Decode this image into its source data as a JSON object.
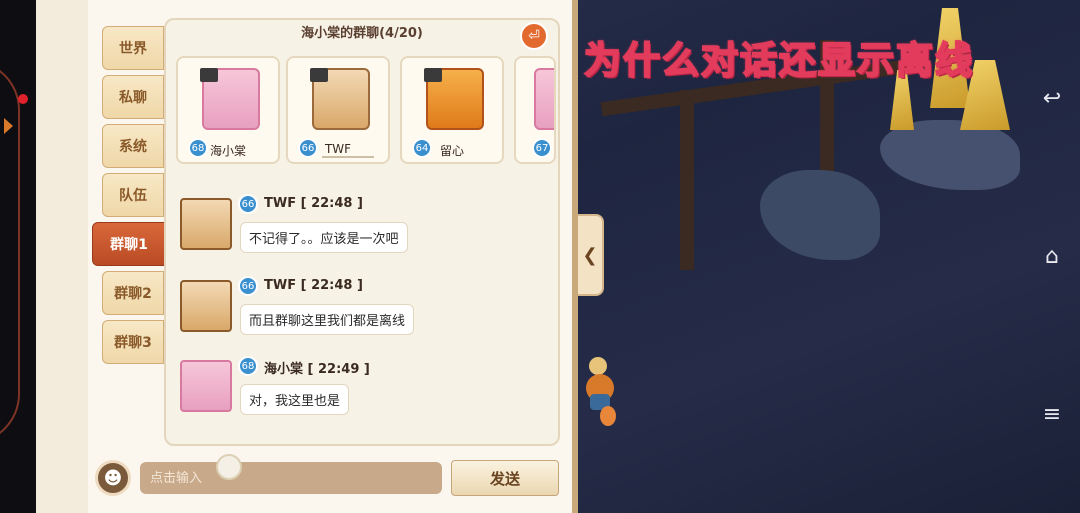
{
  "overlay_caption": "为什么对话还显示离线",
  "tabs": [
    {
      "label": "世界",
      "active": false
    },
    {
      "label": "私聊",
      "active": false
    },
    {
      "label": "系统",
      "active": false
    },
    {
      "label": "队伍",
      "active": false
    },
    {
      "label": "群聊1",
      "active": true
    },
    {
      "label": "群聊2",
      "active": false
    },
    {
      "label": "群聊3",
      "active": false
    }
  ],
  "group": {
    "title": "海小棠的群聊(4/20)",
    "members": [
      {
        "name": "海小棠",
        "level": "68"
      },
      {
        "name": "TWF",
        "level": "66"
      },
      {
        "name": "留心",
        "level": "64"
      },
      {
        "name": "",
        "level": "67"
      }
    ]
  },
  "messages": [
    {
      "level": "66",
      "meta": "TWF  [ 22:48 ]",
      "text": "不记得了。。应该是一次吧"
    },
    {
      "level": "66",
      "meta": "TWF  [ 22:48 ]",
      "text": "而且群聊这里我们都是离线"
    },
    {
      "level": "68",
      "meta": "海小棠  [ 22:49 ]",
      "text": "对，我这里也是"
    }
  ],
  "input": {
    "placeholder": "点击输入",
    "value": ""
  },
  "send_label": "发送",
  "nav_icons": {
    "back": "↩",
    "home": "⌂",
    "menu": "≡"
  },
  "colors": {
    "active_tab": "#c4552c",
    "level_badge": "#3a8fcf",
    "caption_stroke": "#e23b5b"
  }
}
